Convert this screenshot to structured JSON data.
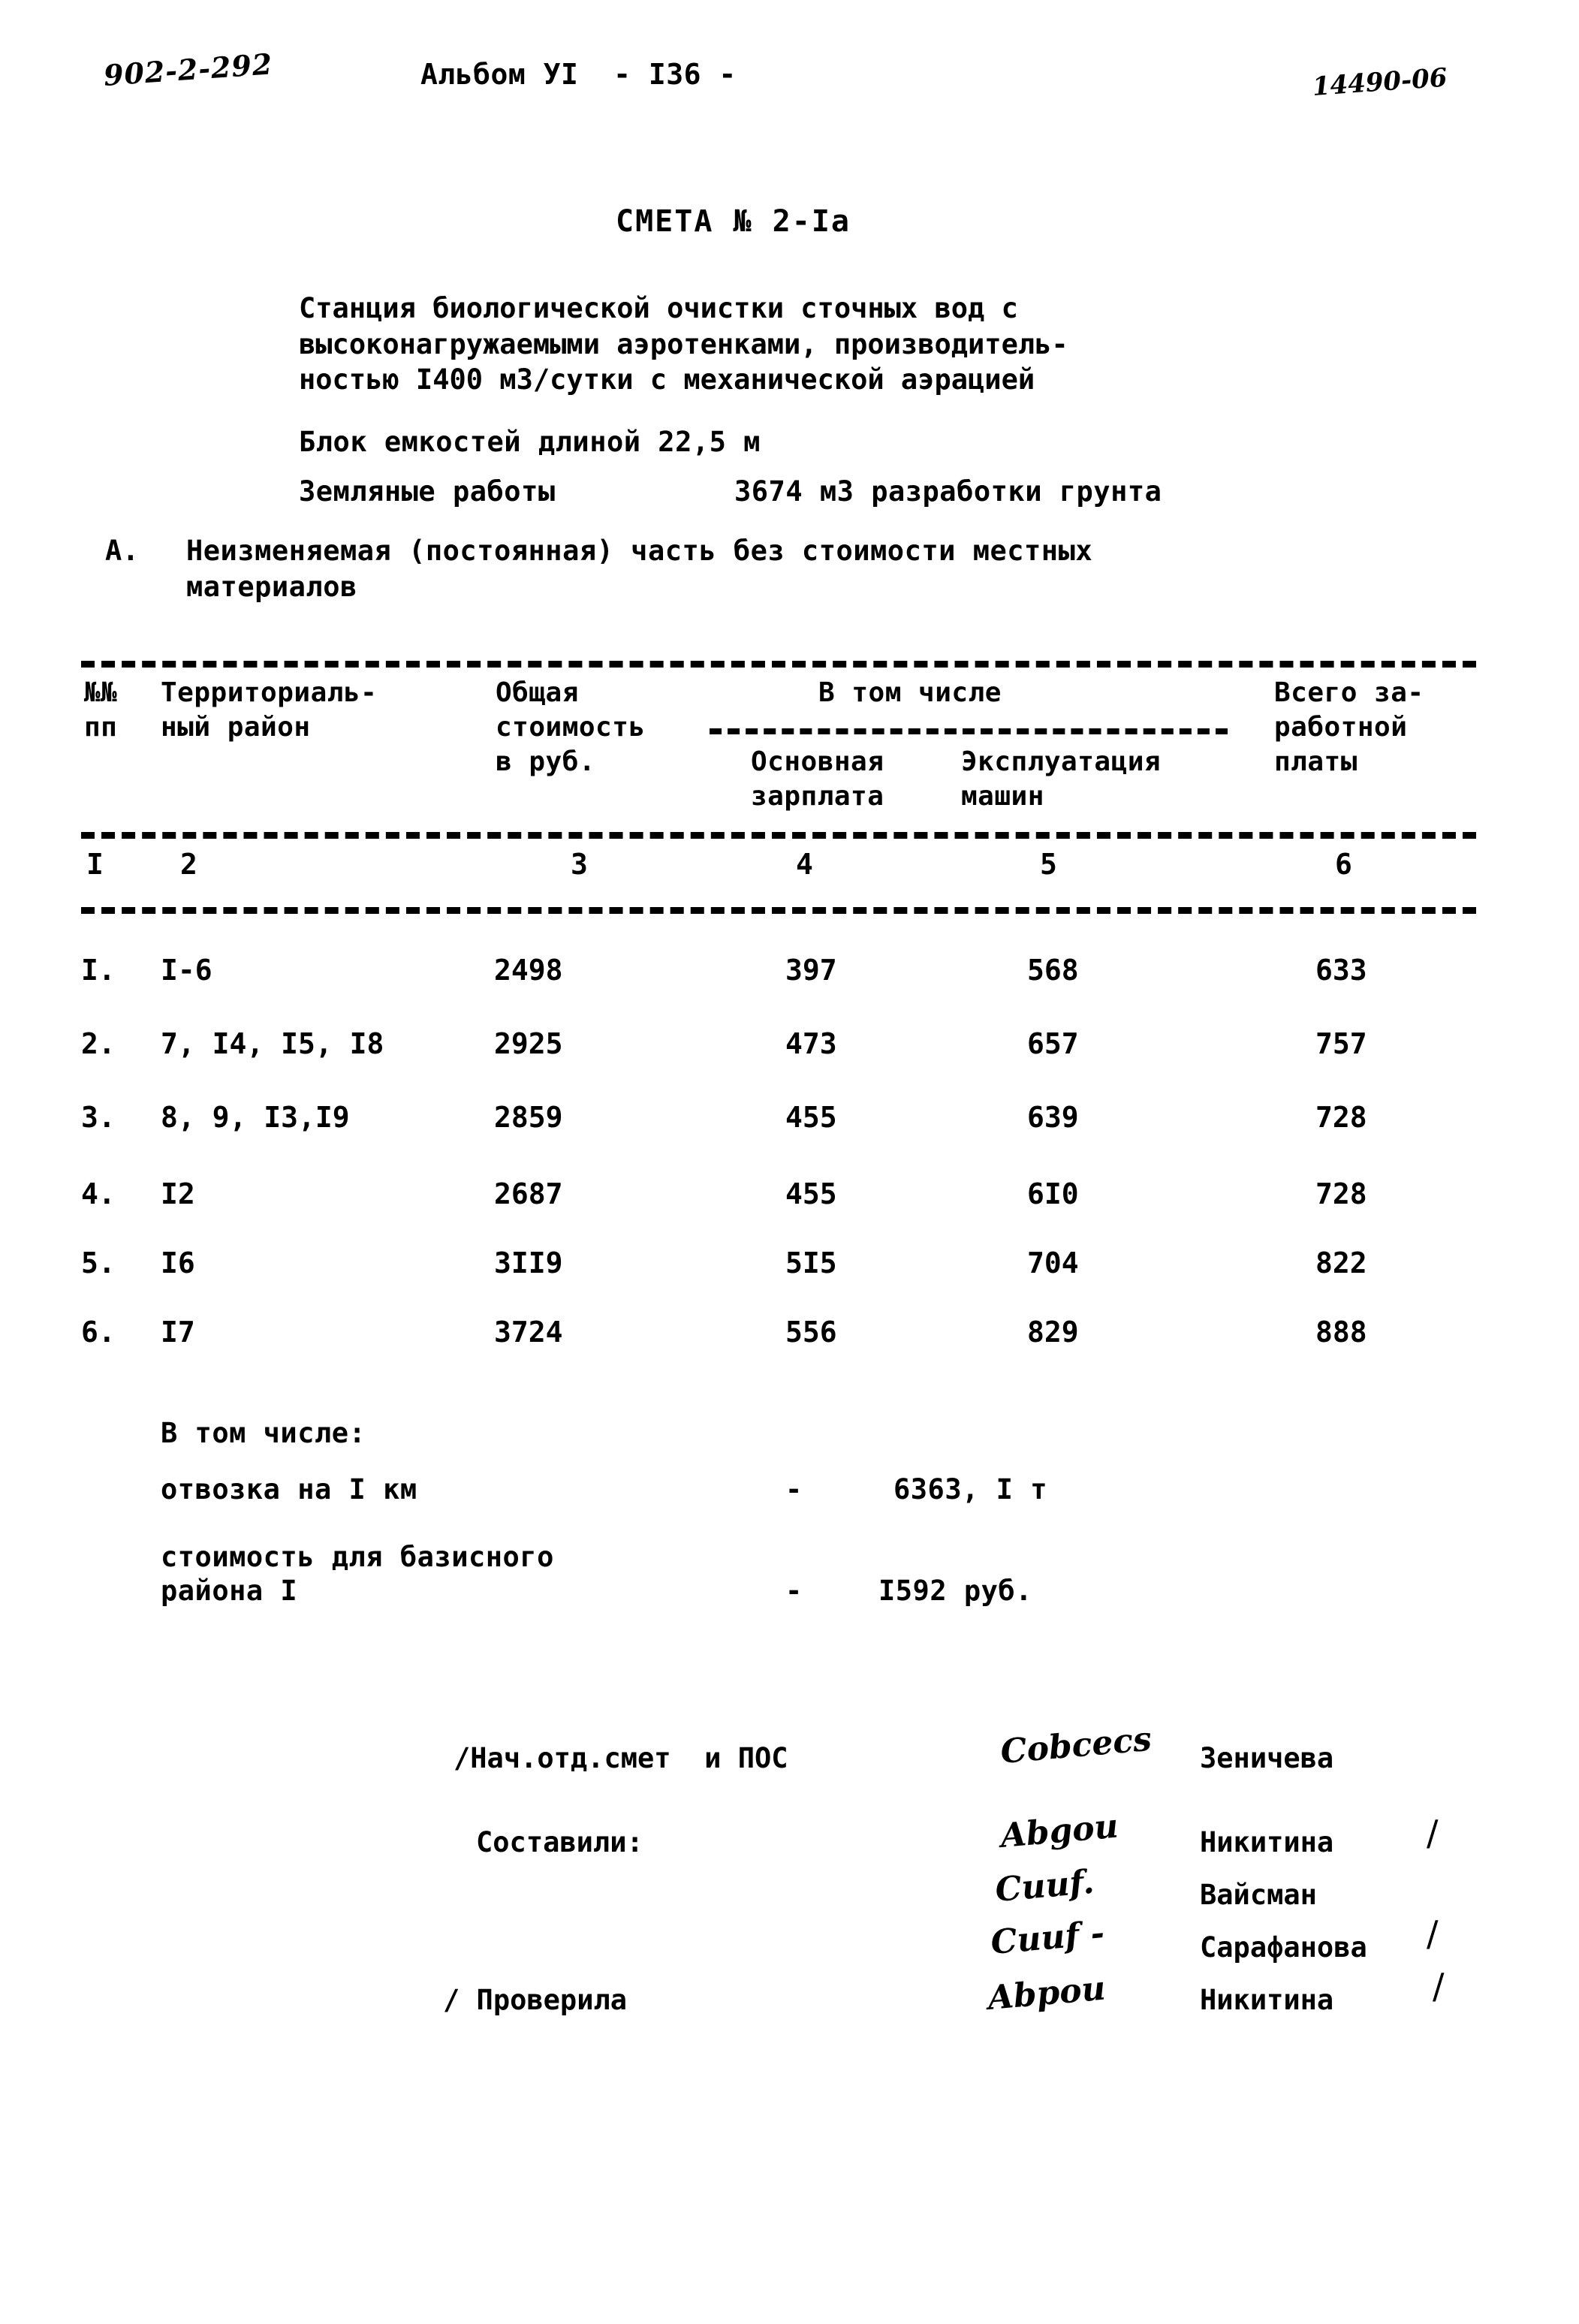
{
  "header": {
    "doc_code": "902-2-292",
    "album_line": "Альбом УI  - I36 -",
    "sheet_stamp": "14490-06"
  },
  "title": "СМЕТА № 2-Iа",
  "description": {
    "line1": "Станция биологической очистки сточных вод с",
    "line2": "высоконагружаемыми аэротенками, производитель-",
    "line3": "ностью I400 м3/сутки с механической аэрацией",
    "block": "Блок емкостей длиной 22,5 м",
    "earthworks_label": "Земляные работы",
    "earthworks_value": "3674 м3 разработки грунта"
  },
  "section_a": {
    "letter": "А.",
    "line1": "Неизменяемая (постоянная) часть без стоимости местных",
    "line2": "материалов"
  },
  "table": {
    "headers": {
      "num": "№№\nпп",
      "region": "Территориаль-\nный район",
      "total_cost": "Общая\nстоимость\nв руб.",
      "group": "В том числе",
      "salary": "Основная\nзарплата",
      "machines": "Эксплуатация\nмашин",
      "wages_total": "Всего за-\nработной\nплаты"
    },
    "column_numbers": [
      "I",
      "2",
      "3",
      "4",
      "5",
      "6"
    ],
    "rows": [
      {
        "no": "I.",
        "region": "I-6",
        "total": "2498",
        "salary": "397",
        "machines": "568",
        "wages": "633"
      },
      {
        "no": "2.",
        "region": "7, I4, I5, I8",
        "total": "2925",
        "salary": "473",
        "machines": "657",
        "wages": "757"
      },
      {
        "no": "3.",
        "region": "8, 9, I3,I9",
        "total": "2859",
        "salary": "455",
        "machines": "639",
        "wages": "728"
      },
      {
        "no": "4.",
        "region": "I2",
        "total": "2687",
        "salary": "455",
        "machines": "6I0",
        "wages": "728"
      },
      {
        "no": "5.",
        "region": "I6",
        "total": "3II9",
        "salary": "5I5",
        "machines": "704",
        "wages": "822"
      },
      {
        "no": "6.",
        "region": "I7",
        "total": "3724",
        "salary": "556",
        "machines": "829",
        "wages": "888"
      }
    ]
  },
  "notes": {
    "heading": "В том числе:",
    "item1_label": "отвозка на I км",
    "item1_dash": "-",
    "item1_value": "6363, I т",
    "item2_label_line1": "стоимость для базисного",
    "item2_label_line2": "района I",
    "item2_dash": "-",
    "item2_value": "I592 руб."
  },
  "signatures": {
    "role1": "/Нач.отд.смет  и ПОС",
    "role2": "Составили:",
    "role3": "/ Проверила",
    "name1": "Зеничева",
    "name2": "Никитина",
    "name3": "Вайсман",
    "name4": "Сарафанова",
    "name5": "Никитина",
    "scribble1": "Cobcecs",
    "scribble2": "Abgou",
    "scribble3": "Cuuf.",
    "scribble4": "Cuuf -",
    "scribble5": "Abpou",
    "slash": "/"
  }
}
